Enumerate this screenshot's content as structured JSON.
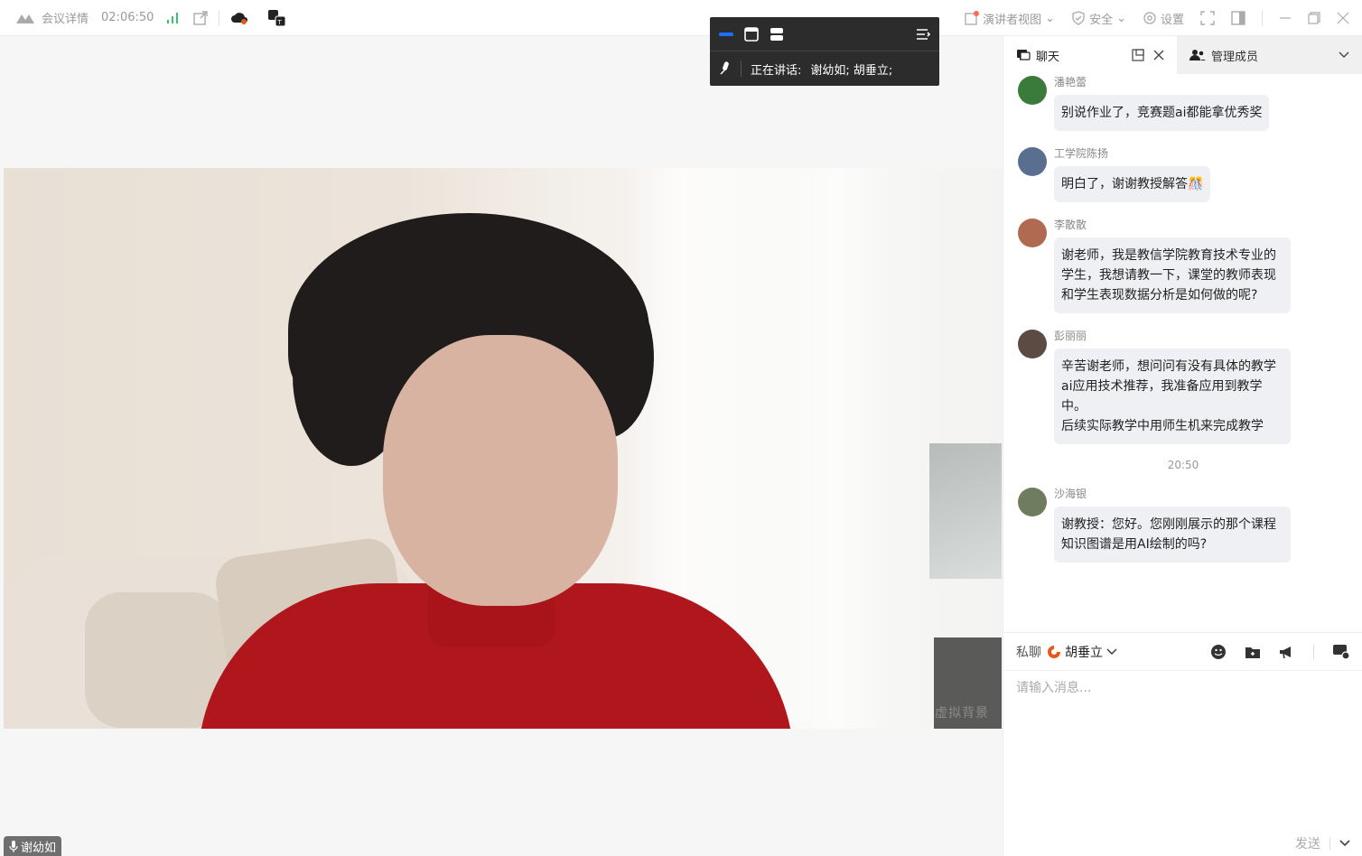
{
  "titlebar": {
    "meeting_details": "会议详情",
    "duration": "02:06:50",
    "presenter_view": "演讲者视图",
    "security": "安全",
    "settings": "设置",
    "icons": [
      "meeting-logo-icon",
      "signal-icon",
      "share-out-icon",
      "cloud-record-icon",
      "translate-icon",
      "presenter-view-icon",
      "shield-icon",
      "gear-icon",
      "fullscreen-icon",
      "sidebar-toggle-icon",
      "minimize-icon",
      "restore-icon",
      "close-icon"
    ]
  },
  "floating_bar": {
    "speaking_label": "正在讲话:",
    "speakers": "谢幼如; 胡垂立;"
  },
  "video": {
    "watermark": "虚拟背景",
    "participant_name": "谢幼如"
  },
  "panel": {
    "chat_tab": "聊天",
    "members_tab": "管理成员"
  },
  "messages": [
    {
      "sender": "潘艳蕾",
      "text": "别说作业了，竞赛题ai都能拿优秀奖",
      "avatar_color": "#3a7a3a"
    },
    {
      "sender": "工学院陈扬",
      "text": "明白了，谢谢教授解答🎊",
      "avatar_color": "#5a6f8f"
    },
    {
      "sender": "李散散",
      "text": "谢老师，我是教信学院教育技术专业的学生，我想请教一下，课堂的教师表现和学生表现数据分析是如何做的呢?",
      "avatar_color": "#b06a52"
    },
    {
      "sender": "彭丽丽",
      "text": "辛苦谢老师，想问问有没有具体的教学ai应用技术推荐，我准备应用到教学中。\n后续实际教学中用师生机来完成教学",
      "avatar_color": "#5c4a44"
    },
    {
      "sender": "沙海银",
      "text": "谢教授：您好。您刚刚展示的那个课程知识图谱是用AI绘制的吗?",
      "avatar_color": "#6f7d5e",
      "timestamp_before": "20:50"
    }
  ],
  "composer": {
    "private_label": "私聊",
    "recipient": "胡垂立",
    "placeholder": "请输入消息...",
    "send_label": "发送"
  },
  "colors": {
    "accent_blue": "#1e6fff",
    "brand_orange": "#e8581b",
    "signal_green": "#38c26e"
  }
}
